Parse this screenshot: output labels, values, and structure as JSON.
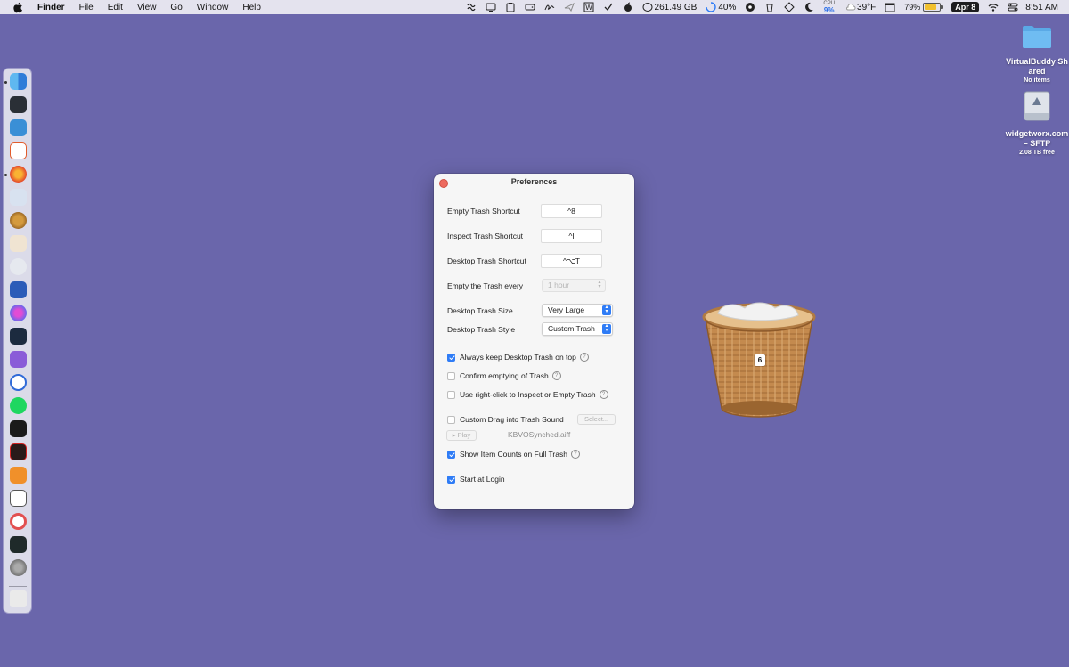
{
  "menubar": {
    "app_name": "Finder",
    "menus": [
      "File",
      "Edit",
      "View",
      "Go",
      "Window",
      "Help"
    ],
    "disk_free": "261.49 GB",
    "progress_text": "40%",
    "cpu_label": "CPU",
    "cpu_value": "9%",
    "weather": "39°F",
    "battery_text": "79%",
    "battery_level": 0.79,
    "date": "Apr 8",
    "time": "8:51 AM",
    "status_icons": [
      "monitor-icon",
      "screen-icon",
      "clipboard-icon",
      "drive-icon",
      "signature-icon",
      "plane-icon",
      "w-icon",
      "check-icon",
      "apple-icon",
      "progress-icon",
      "soccer-icon",
      "trash-icon",
      "diamond-icon",
      "moon-icon",
      "cloud-icon",
      "calendar-icon",
      "wifi-icon",
      "control-center-icon"
    ]
  },
  "desktop": {
    "icons": [
      {
        "label": "VirtualBuddy Shared",
        "sub": "No items",
        "icon": "folder-icon"
      },
      {
        "label": "widgetworx.com – SFTP",
        "sub": "2.08 TB free",
        "icon": "network-drive-icon"
      }
    ],
    "trash_badge": "6"
  },
  "dock": {
    "apps": [
      "finder",
      "xcode-instruments",
      "utility-tools",
      "brave",
      "firefox",
      "screen-sharing",
      "acorn",
      "preview",
      "bbedit",
      "word",
      "arc",
      "infuse",
      "downloader",
      "podcast",
      "spotify",
      "terminal",
      "screen-record",
      "beta-app",
      "layers",
      "circle-app",
      "activity-monitor",
      "system-settings",
      "trash"
    ]
  },
  "prefs": {
    "title": "Preferences",
    "empty_trash_shortcut_label": "Empty Trash Shortcut",
    "empty_trash_shortcut": "^8",
    "inspect_trash_shortcut_label": "Inspect Trash Shortcut",
    "inspect_trash_shortcut": "^I",
    "desktop_trash_shortcut_label": "Desktop Trash Shortcut",
    "desktop_trash_shortcut": "^⌥T",
    "empty_every_label": "Empty the Trash every",
    "empty_every_value": "1 hour",
    "size_label": "Desktop Trash Size",
    "size_value": "Very Large",
    "style_label": "Desktop Trash Style",
    "style_value": "Custom Trash",
    "keep_on_top_label": "Always keep Desktop Trash on top",
    "keep_on_top": true,
    "confirm_empty_label": "Confirm emptying of Trash",
    "confirm_empty": false,
    "right_click_label": "Use right-click to Inspect or Empty Trash",
    "right_click": false,
    "custom_sound_label": "Custom Drag into Trash Sound",
    "custom_sound": false,
    "select_button": "Select...",
    "play_button": "▸ Play",
    "sound_file": "KBVOSynched.aiff",
    "item_counts_label": "Show Item Counts on Full Trash",
    "item_counts": true,
    "start_login_label": "Start at Login",
    "start_login": true
  }
}
